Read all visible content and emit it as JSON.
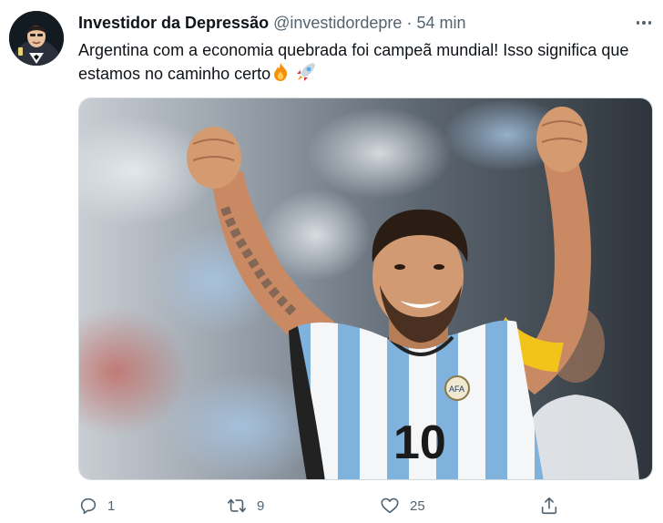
{
  "tweet": {
    "display_name": "Investidor da Depressão",
    "handle": "@investidordepre",
    "separator": "·",
    "timestamp": "54 min",
    "text": "Argentina com a economia quebrada foi campeã mundial! Isso significa que estamos no caminho certo",
    "emojis": [
      "fire-emoji",
      "rocket-emoji"
    ],
    "media": {
      "alt_icon": "photo",
      "jersey_number": "10",
      "badge_text": "AFA"
    },
    "actions": {
      "reply_count": "1",
      "retweet_count": "9",
      "like_count": "25"
    }
  },
  "colors": {
    "text_primary": "#0f1419",
    "text_secondary": "#536471",
    "jersey_blue": "#7fb3dd",
    "armband_yellow": "#f2c31a"
  }
}
